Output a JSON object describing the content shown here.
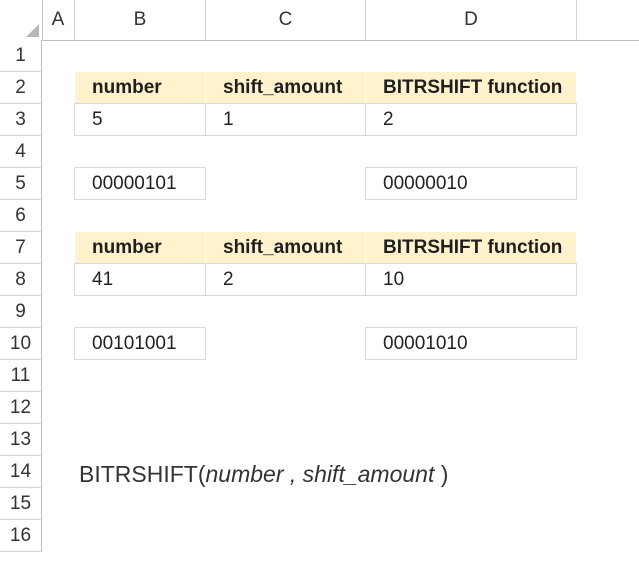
{
  "sheet": {
    "columns": [
      "A",
      "B",
      "C",
      "D"
    ],
    "rows": [
      "1",
      "2",
      "3",
      "4",
      "5",
      "6",
      "7",
      "8",
      "9",
      "10",
      "11",
      "12",
      "13",
      "14",
      "15",
      "16"
    ]
  },
  "table1": {
    "headers": [
      "number",
      "shift_amount",
      "BITRSHIFT function"
    ],
    "values": [
      "5",
      "1",
      "2"
    ],
    "binary_number": "00000101",
    "binary_result": "00000010"
  },
  "table2": {
    "headers": [
      "number",
      "shift_amount",
      "BITRSHIFT function"
    ],
    "values": [
      "41",
      "2",
      "10"
    ],
    "binary_number": "00101001",
    "binary_result": "00001010"
  },
  "syntax": {
    "func": "BITRSHIFT(",
    "arg1": "number",
    "sep": " , ",
    "arg2": "shift_amount",
    "close": " )"
  },
  "colors": {
    "header_fill": "#fff2cc",
    "gridline": "#d4d4d4"
  }
}
